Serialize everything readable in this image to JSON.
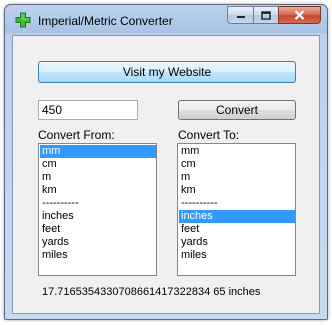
{
  "window": {
    "title": "Imperial/Metric Converter"
  },
  "website_button": "Visit my Website",
  "input": {
    "value": "450"
  },
  "convert_button": "Convert",
  "from": {
    "label": "Convert From:",
    "items": [
      "mm",
      "cm",
      "m",
      "km",
      "----------",
      "inches",
      "feet",
      "yards",
      "miles"
    ],
    "selected": "mm"
  },
  "to": {
    "label": "Convert To:",
    "items": [
      "mm",
      "cm",
      "m",
      "km",
      "----------",
      "inches",
      "feet",
      "yards",
      "miles"
    ],
    "selected": "inches"
  },
  "result": "17.7165354330708661417322834 65 inches",
  "colors": {
    "selection": "#3399ff",
    "accent_button": "#3c7fb1",
    "close_button": "#c44a2f",
    "app_icon": "#33aa33"
  },
  "icons": [
    "app-plus-icon",
    "minimize-icon",
    "maximize-icon",
    "close-icon"
  ]
}
